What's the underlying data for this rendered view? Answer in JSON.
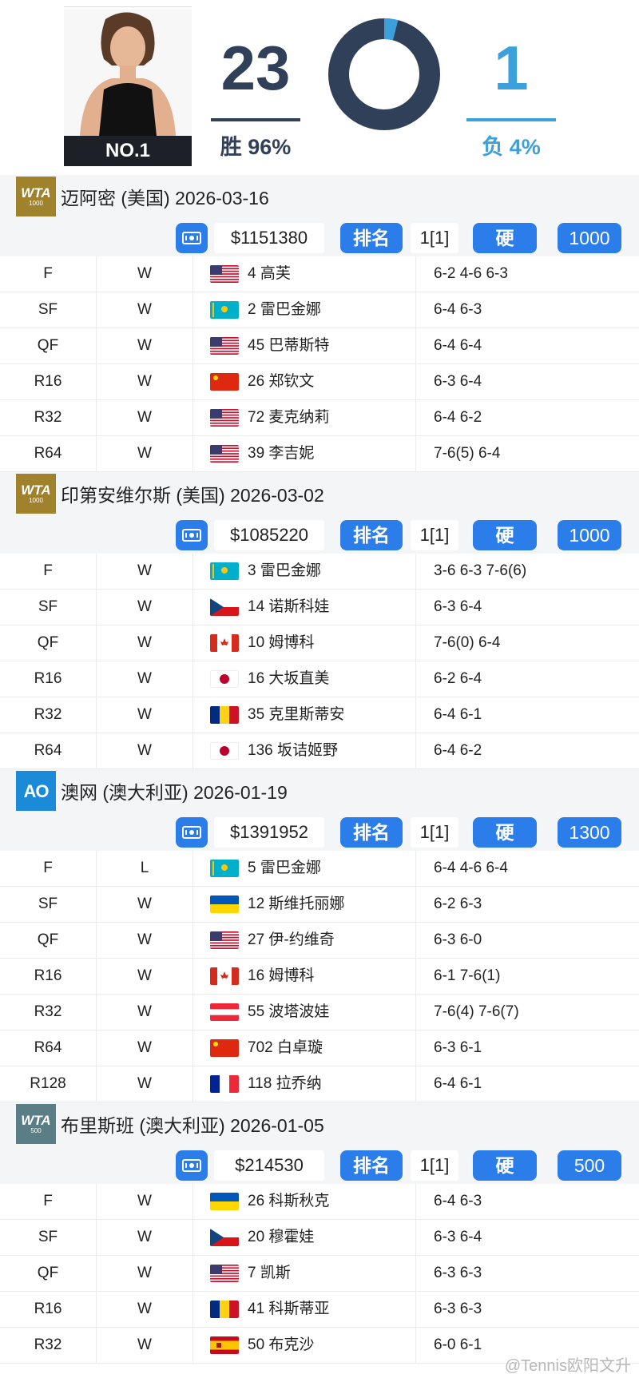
{
  "player": {
    "rank_badge": "NO.1",
    "wins": "23",
    "win_label": "胜 96%",
    "losses": "1",
    "loss_label": "负 4%",
    "win_pct": 96,
    "loss_pct": 4
  },
  "colors": {
    "win": "#2f4058",
    "loss": "#3ba0dc",
    "accent": "#2b7de9",
    "wta1000": "#a0822d",
    "wta500": "#5b7e86",
    "ao": "#1b8ad8"
  },
  "tournaments": [
    {
      "logo": "wta1000",
      "logo_l1": "WTA",
      "logo_l2": "1000",
      "title": "迈阿密 (美国) 2026-03-16",
      "prize": "$1151380",
      "rank_label": "排名",
      "rank": "1[1]",
      "surface": "硬",
      "points": "1000",
      "matches": [
        {
          "round": "F",
          "result": "W",
          "flag": "usa",
          "opponent": "4 高芙",
          "score": "6-2 4-6 6-3"
        },
        {
          "round": "SF",
          "result": "W",
          "flag": "kaz",
          "opponent": "2 雷巴金娜",
          "score": "6-4 6-3"
        },
        {
          "round": "QF",
          "result": "W",
          "flag": "usa",
          "opponent": "45 巴蒂斯特",
          "score": "6-4 6-4"
        },
        {
          "round": "R16",
          "result": "W",
          "flag": "chn",
          "opponent": "26 郑钦文",
          "score": "6-3 6-4"
        },
        {
          "round": "R32",
          "result": "W",
          "flag": "usa",
          "opponent": "72 麦克纳莉",
          "score": "6-4 6-2"
        },
        {
          "round": "R64",
          "result": "W",
          "flag": "usa",
          "opponent": "39 李吉妮",
          "score": "7-6(5) 6-4"
        }
      ]
    },
    {
      "logo": "wta1000",
      "logo_l1": "WTA",
      "logo_l2": "1000",
      "title": "印第安维尔斯 (美国) 2026-03-02",
      "prize": "$1085220",
      "rank_label": "排名",
      "rank": "1[1]",
      "surface": "硬",
      "points": "1000",
      "matches": [
        {
          "round": "F",
          "result": "W",
          "flag": "kaz",
          "opponent": "3 雷巴金娜",
          "score": "3-6 6-3 7-6(6)"
        },
        {
          "round": "SF",
          "result": "W",
          "flag": "cze",
          "opponent": "14 诺斯科娃",
          "score": "6-3 6-4"
        },
        {
          "round": "QF",
          "result": "W",
          "flag": "can",
          "opponent": "10 姆博科",
          "score": "7-6(0) 6-4"
        },
        {
          "round": "R16",
          "result": "W",
          "flag": "jpn",
          "opponent": "16 大坂直美",
          "score": "6-2 6-4"
        },
        {
          "round": "R32",
          "result": "W",
          "flag": "rou",
          "opponent": "35 克里斯蒂安",
          "score": "6-4 6-1"
        },
        {
          "round": "R64",
          "result": "W",
          "flag": "jpn",
          "opponent": "136 坂诘姬野",
          "score": "6-4 6-2"
        }
      ]
    },
    {
      "logo": "ao",
      "logo_l1": "AO",
      "logo_l2": "",
      "title": "澳网 (澳大利亚) 2026-01-19",
      "prize": "$1391952",
      "rank_label": "排名",
      "rank": "1[1]",
      "surface": "硬",
      "points": "1300",
      "matches": [
        {
          "round": "F",
          "result": "L",
          "flag": "kaz",
          "opponent": "5 雷巴金娜",
          "score": "6-4 4-6 6-4"
        },
        {
          "round": "SF",
          "result": "W",
          "flag": "ukr",
          "opponent": "12 斯维托丽娜",
          "score": "6-2 6-3"
        },
        {
          "round": "QF",
          "result": "W",
          "flag": "usa",
          "opponent": "27 伊-约维奇",
          "score": "6-3 6-0"
        },
        {
          "round": "R16",
          "result": "W",
          "flag": "can",
          "opponent": "16 姆博科",
          "score": "6-1 7-6(1)"
        },
        {
          "round": "R32",
          "result": "W",
          "flag": "aut",
          "opponent": "55 波塔波娃",
          "score": "7-6(4) 7-6(7)"
        },
        {
          "round": "R64",
          "result": "W",
          "flag": "chn",
          "opponent": "702 白卓璇",
          "score": "6-3 6-1"
        },
        {
          "round": "R128",
          "result": "W",
          "flag": "fra",
          "opponent": "118 拉乔纳",
          "score": "6-4 6-1"
        }
      ]
    },
    {
      "logo": "wta500",
      "logo_l1": "WTA",
      "logo_l2": "500",
      "title": "布里斯班 (澳大利亚) 2026-01-05",
      "prize": "$214530",
      "rank_label": "排名",
      "rank": "1[1]",
      "surface": "硬",
      "points": "500",
      "matches": [
        {
          "round": "F",
          "result": "W",
          "flag": "ukr",
          "opponent": "26 科斯秋克",
          "score": "6-4 6-3"
        },
        {
          "round": "SF",
          "result": "W",
          "flag": "cze",
          "opponent": "20 穆霍娃",
          "score": "6-3 6-4"
        },
        {
          "round": "QF",
          "result": "W",
          "flag": "usa",
          "opponent": "7 凯斯",
          "score": "6-3 6-3"
        },
        {
          "round": "R16",
          "result": "W",
          "flag": "rou",
          "opponent": "41 科斯蒂亚",
          "score": "6-3 6-3"
        },
        {
          "round": "R32",
          "result": "W",
          "flag": "esp",
          "opponent": "50 布克沙",
          "score": "6-0 6-1"
        }
      ]
    }
  ],
  "watermark": "@Tennis欧阳文升"
}
